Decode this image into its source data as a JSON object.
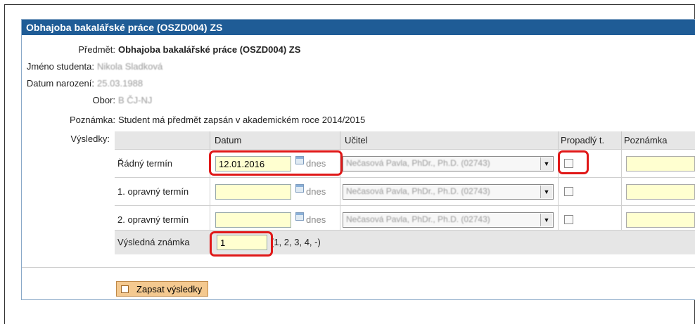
{
  "panel": {
    "title": "Obhajoba bakalářské práce (OSZD004) ZS"
  },
  "info": {
    "subject_label": "Předmět:",
    "subject_value": "Obhajoba bakalářské práce (OSZD004) ZS",
    "student_label": "Jméno studenta:",
    "student_value": "Nikola Sladková",
    "birth_label": "Datum narození:",
    "birth_value": "25.03.1988",
    "field_label": "Obor:",
    "field_value": "B ČJ-NJ",
    "note_label": "Poznámka:",
    "note_value": "Student má předmět zapsán v akademickém roce 2014/2015",
    "results_label": "Výsledky:"
  },
  "table": {
    "headers": {
      "date": "Datum",
      "teacher": "Učitel",
      "failed": "Propadlý t.",
      "note": "Poznámka"
    },
    "rows": [
      {
        "label": "Řádný termín",
        "date": "12.01.2016",
        "today": "dnes",
        "teacher": "Nečasová Pavla, PhDr., Ph.D. (02743)"
      },
      {
        "label": "1. opravný termín",
        "date": "",
        "today": "dnes",
        "teacher": "Nečasová Pavla, PhDr., Ph.D. (02743)"
      },
      {
        "label": "2. opravný termín",
        "date": "",
        "today": "dnes",
        "teacher": "Nečasová Pavla, PhDr., Ph.D. (02743)"
      }
    ],
    "final_grade": {
      "label": "Výsledná známka",
      "value": "1",
      "options": "(1, 2, 3, 4, -)"
    }
  },
  "submit": {
    "label": "Zapsat výsledky"
  },
  "colors": {
    "title_bar": "#1f5c96",
    "input_bg": "#ffffd0",
    "highlight": "#e01818",
    "button": "#f4c990"
  },
  "icons": {
    "calendar": "calendar-icon",
    "dropdown": "chevron-down-icon",
    "submit": "save-icon"
  }
}
